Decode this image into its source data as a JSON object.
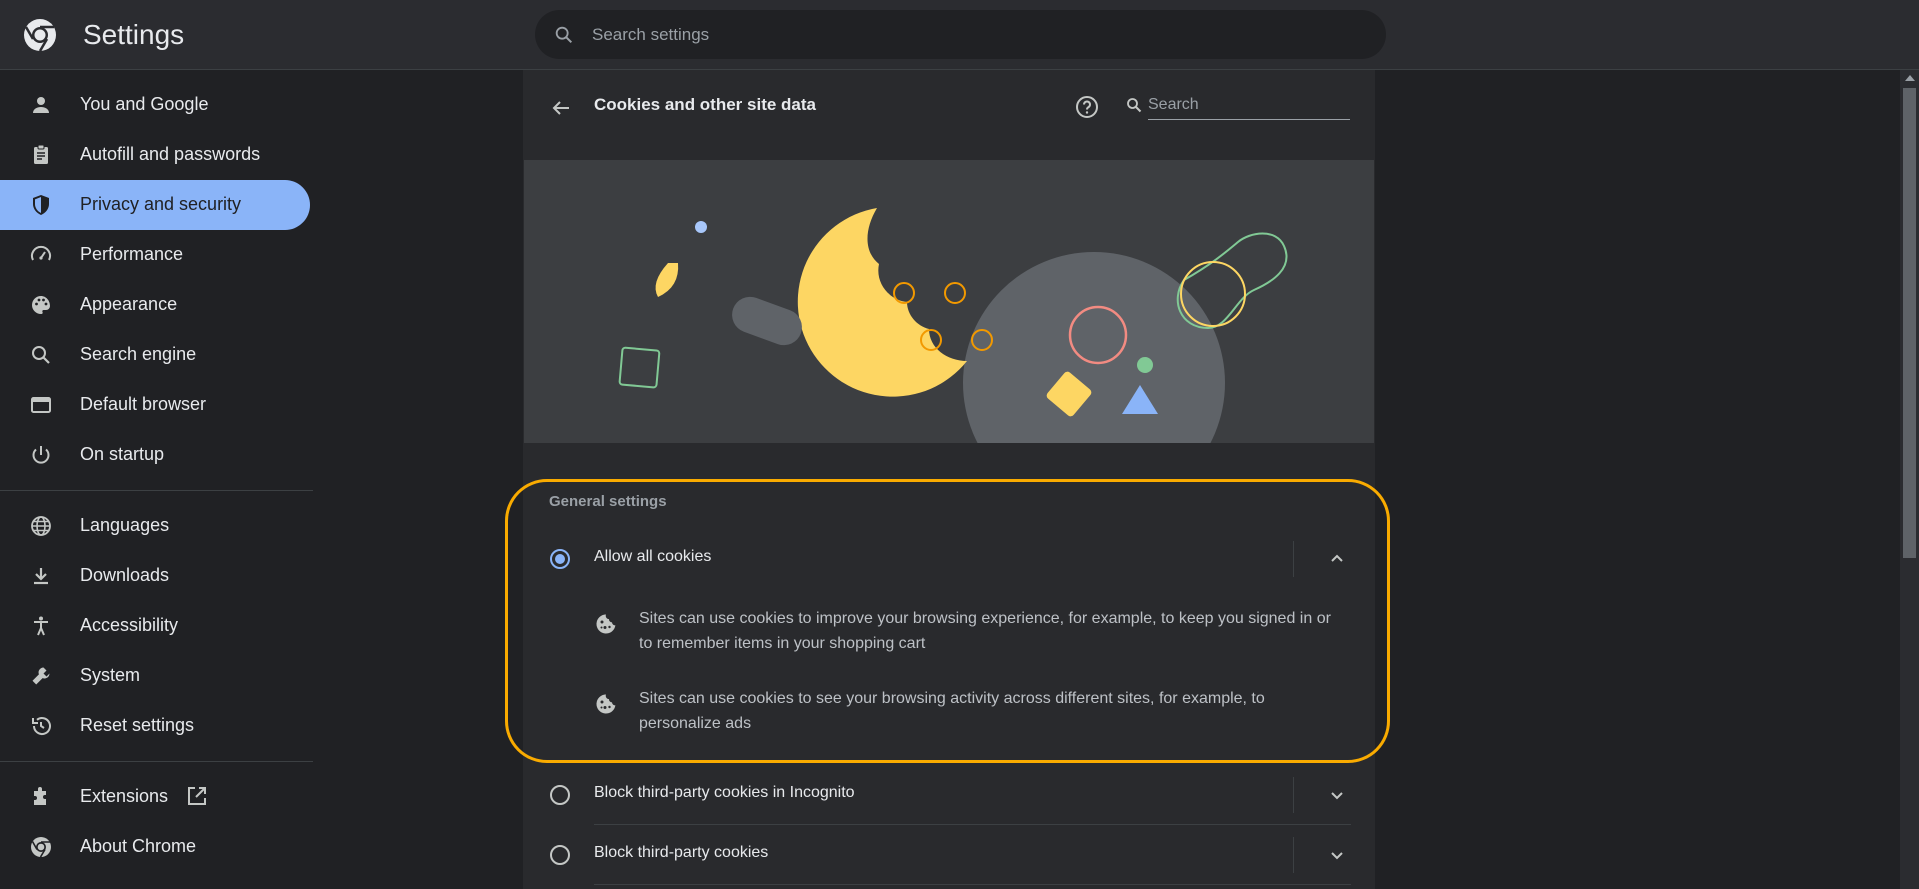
{
  "app": {
    "title": "Settings"
  },
  "search": {
    "placeholder": "Search settings"
  },
  "sidebar": {
    "items": [
      {
        "label": "You and Google",
        "icon": "person-icon"
      },
      {
        "label": "Autofill and passwords",
        "icon": "clipboard-icon"
      },
      {
        "label": "Privacy and security",
        "icon": "shield-icon",
        "active": true
      },
      {
        "label": "Performance",
        "icon": "speedometer-icon"
      },
      {
        "label": "Appearance",
        "icon": "palette-icon"
      },
      {
        "label": "Search engine",
        "icon": "search-icon"
      },
      {
        "label": "Default browser",
        "icon": "browser-icon"
      },
      {
        "label": "On startup",
        "icon": "power-icon"
      },
      {
        "label": "Languages",
        "icon": "globe-icon"
      },
      {
        "label": "Downloads",
        "icon": "download-icon"
      },
      {
        "label": "Accessibility",
        "icon": "accessibility-icon"
      },
      {
        "label": "System",
        "icon": "wrench-icon"
      },
      {
        "label": "Reset settings",
        "icon": "history-icon"
      },
      {
        "label": "Extensions",
        "icon": "puzzle-icon"
      },
      {
        "label": "About Chrome",
        "icon": "chrome-logo-icon"
      }
    ]
  },
  "page": {
    "title": "Cookies and other site data",
    "search_placeholder": "Search",
    "section_label": "General settings",
    "options": [
      {
        "label": "Allow all cookies",
        "selected": true,
        "expanded": true,
        "details": [
          "Sites can use cookies to improve your browsing experience, for example, to keep you signed in or to remember items in your shopping cart",
          "Sites can use cookies to see your browsing activity across different sites, for example, to personalize ads"
        ]
      },
      {
        "label": "Block third-party cookies in Incognito",
        "selected": false,
        "expanded": false
      },
      {
        "label": "Block third-party cookies",
        "selected": false,
        "expanded": false
      }
    ]
  },
  "colors": {
    "accent": "#8ab4f8",
    "highlight": "#f9ab00",
    "background": "#202124",
    "card": "#292a2d"
  }
}
